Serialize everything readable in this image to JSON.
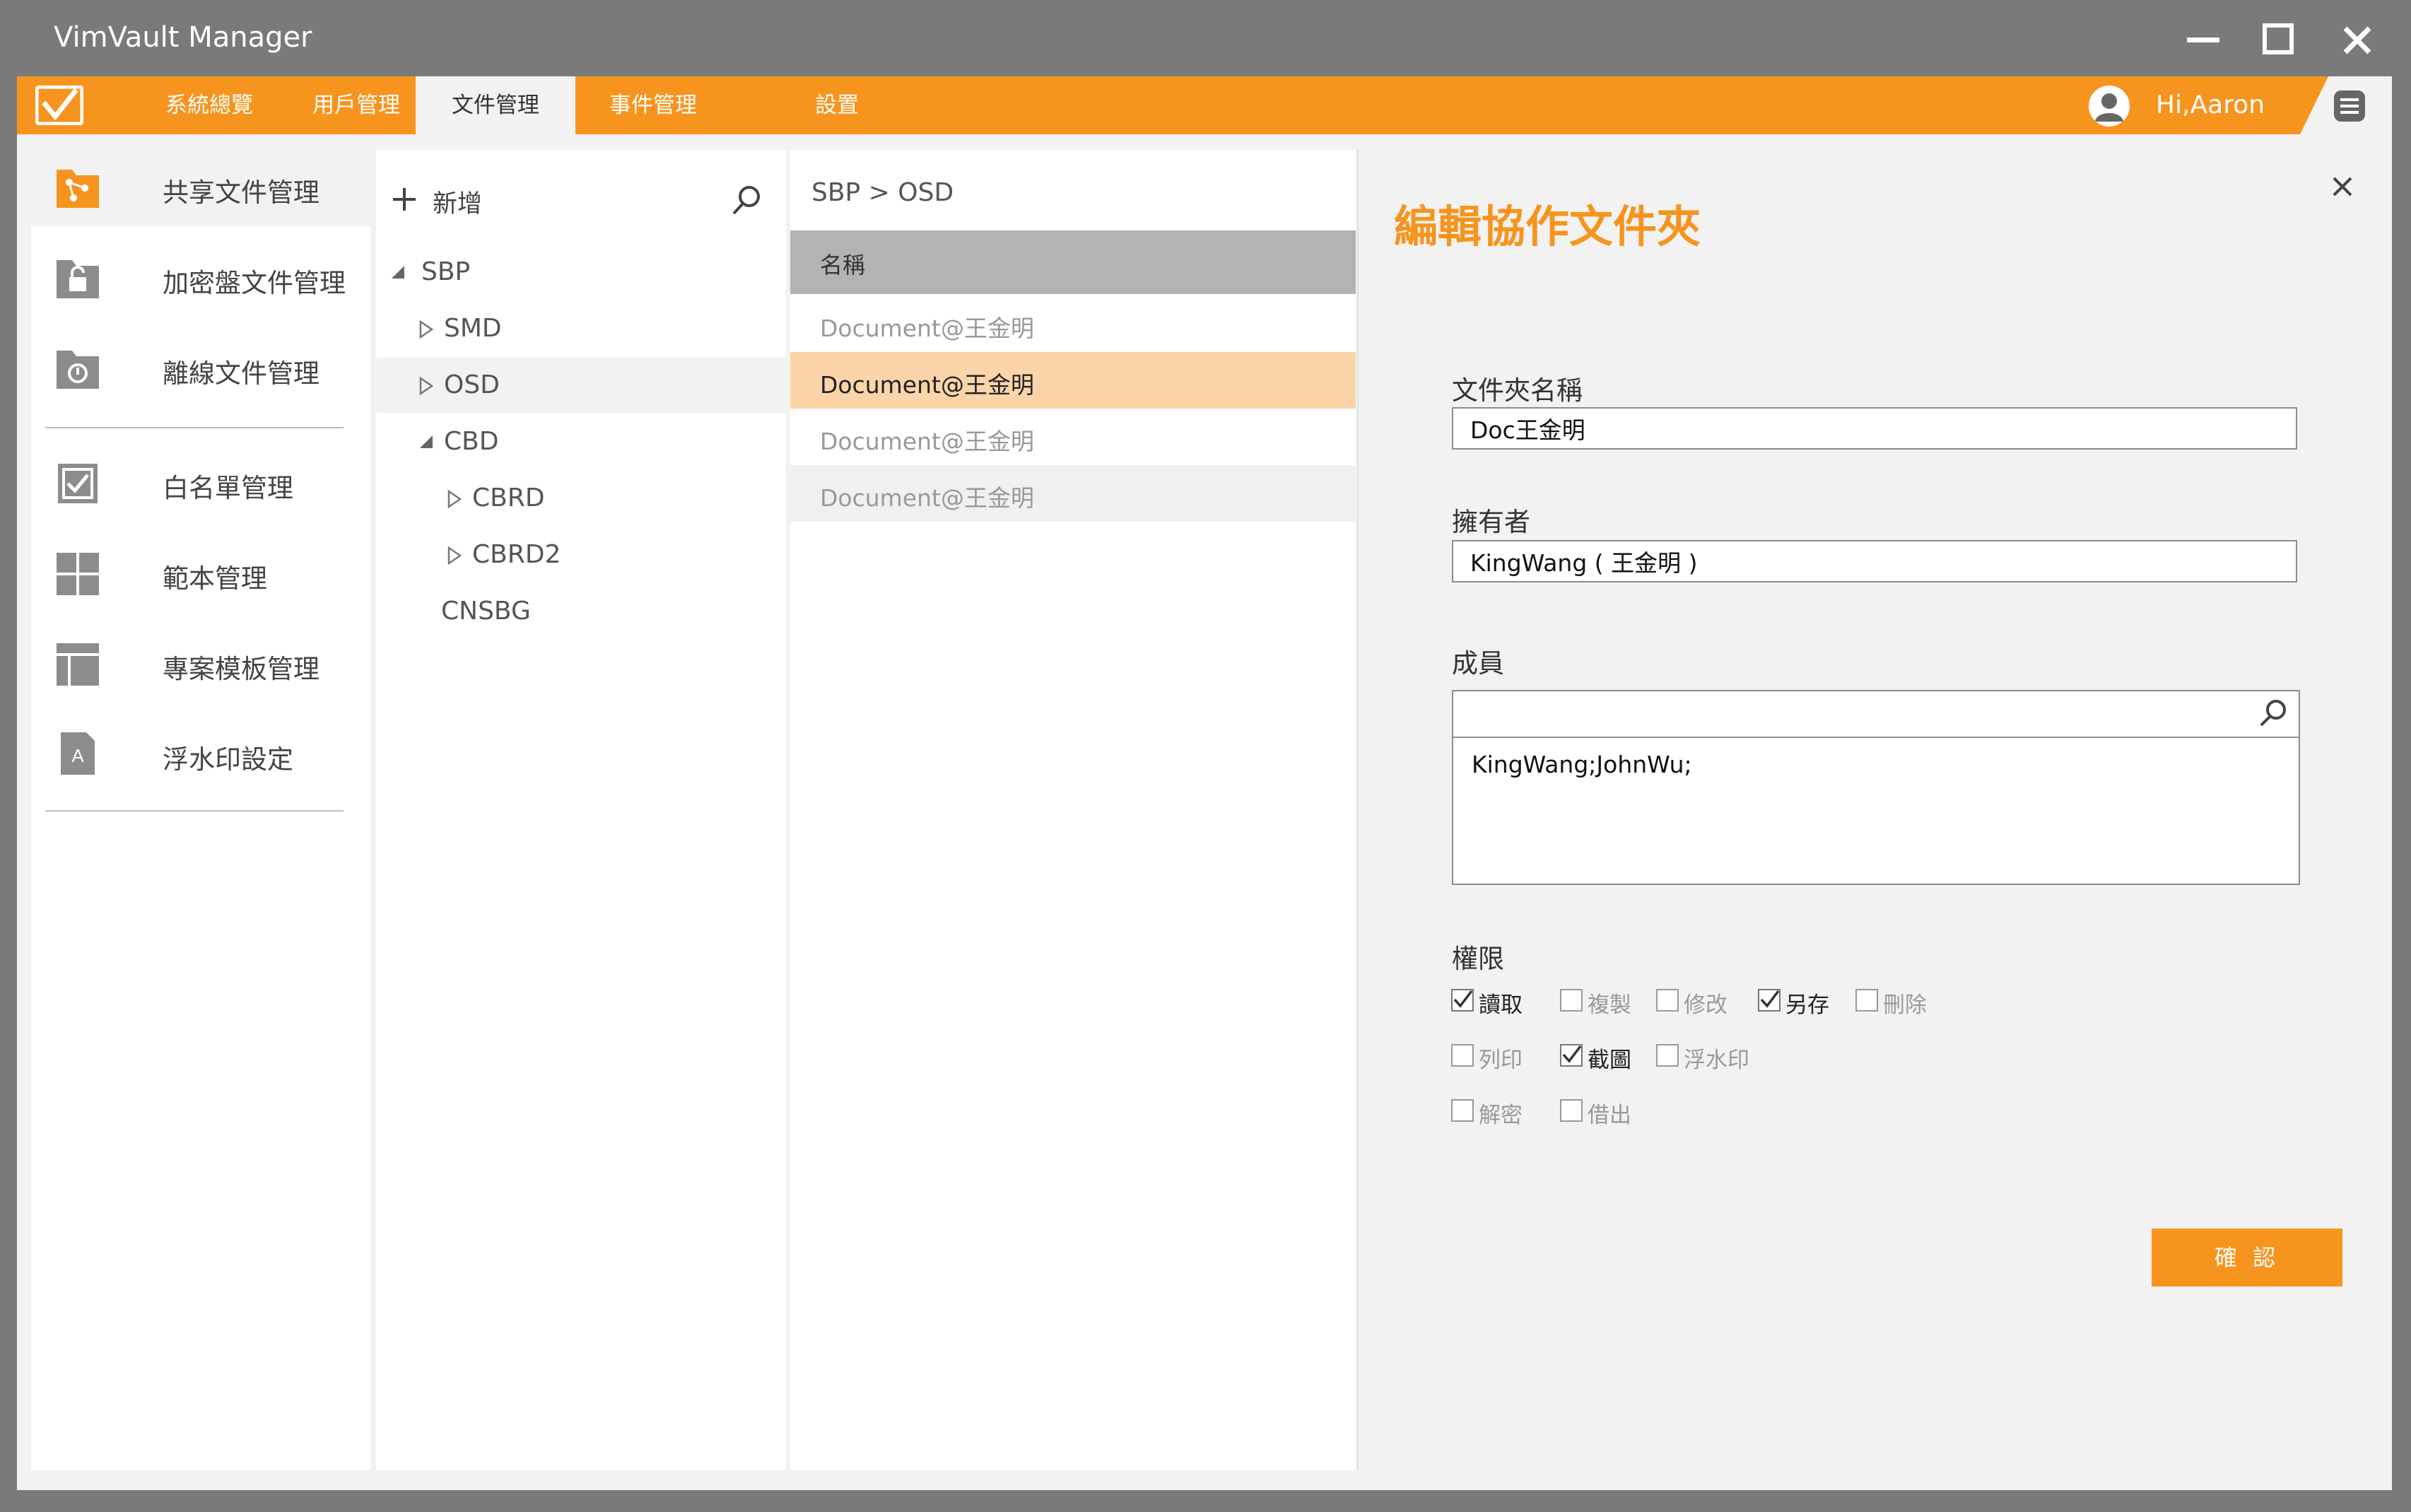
{
  "window": {
    "title": "VimVault Manager"
  },
  "navbar": {
    "items": [
      {
        "label": "系統總覽"
      },
      {
        "label": "用戶管理"
      },
      {
        "label": "文件管理"
      },
      {
        "label": "事件管理"
      },
      {
        "label": "設置"
      }
    ],
    "active_index": 2,
    "user_greeting": "Hi,Aaron"
  },
  "sidebar": {
    "items": [
      {
        "label": "共享文件管理",
        "icon": "share-folder-icon"
      },
      {
        "label": "加密盤文件管理",
        "icon": "lock-folder-icon"
      },
      {
        "label": "離線文件管理",
        "icon": "offline-folder-icon"
      },
      {
        "label": "白名單管理",
        "icon": "checkbox-list-icon"
      },
      {
        "label": "範本管理",
        "icon": "grid-template-icon"
      },
      {
        "label": "專案模板管理",
        "icon": "layout-template-icon"
      },
      {
        "label": "浮水印設定",
        "icon": "watermark-document-icon"
      }
    ],
    "watermark_icon_letter": "A",
    "active_index": 0
  },
  "tree": {
    "add_label": "新增",
    "nodes": [
      {
        "label": "SBP",
        "level": 0,
        "state": "expanded"
      },
      {
        "label": "SMD",
        "level": 1,
        "state": "collapsed"
      },
      {
        "label": "OSD",
        "level": 1,
        "state": "collapsed",
        "selected": true
      },
      {
        "label": "CBD",
        "level": 1,
        "state": "expanded"
      },
      {
        "label": "CBRD",
        "level": 2,
        "state": "collapsed"
      },
      {
        "label": "CBRD2",
        "level": 2,
        "state": "collapsed"
      },
      {
        "label": "CNSBG",
        "level": 1,
        "state": "leaf"
      }
    ]
  },
  "list": {
    "breadcrumb": "SBP > OSD",
    "column_header": "名稱",
    "rows": [
      {
        "name": "Document@王金明"
      },
      {
        "name": "Document@王金明",
        "selected": true
      },
      {
        "name": "Document@王金明"
      },
      {
        "name": "Document@王金明"
      }
    ]
  },
  "edit_panel": {
    "title": "編輯協作文件夾",
    "folder_name_label": "文件夾名稱",
    "folder_name_value": "Doc王金明",
    "owner_label": "擁有者",
    "owner_value": "KingWang ( 王金明 )",
    "members_label": "成員",
    "members_search_value": "",
    "members_list": "KingWang;JohnWu;",
    "permissions_label": "權限",
    "permissions": [
      {
        "label": "讀取",
        "checked": true
      },
      {
        "label": "複製",
        "checked": false
      },
      {
        "label": "修改",
        "checked": false
      },
      {
        "label": "另存",
        "checked": true
      },
      {
        "label": "刪除",
        "checked": false
      },
      {
        "label": "列印",
        "checked": false
      },
      {
        "label": "截圖",
        "checked": true
      },
      {
        "label": "浮水印",
        "checked": false
      },
      {
        "label": "解密",
        "checked": false
      },
      {
        "label": "借出",
        "checked": false
      }
    ],
    "confirm_label": "確 認"
  },
  "colors": {
    "accent": "#f7941d",
    "selected_row": "#fcd4a9",
    "header_grey": "#b3b3b3",
    "titlebar": "#7a7a7a"
  }
}
